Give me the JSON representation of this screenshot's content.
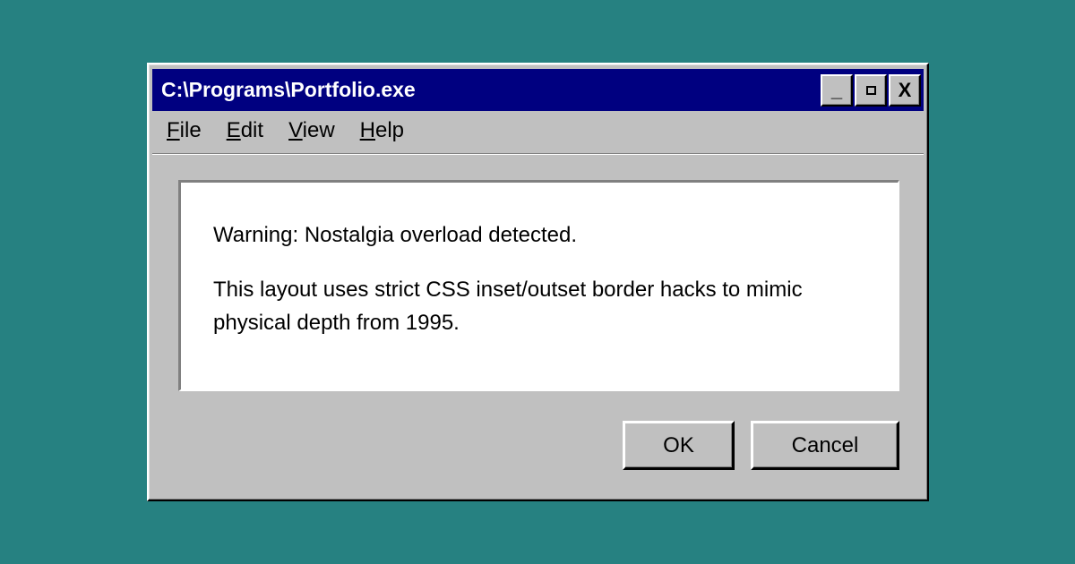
{
  "window": {
    "title": "C:\\Programs\\Portfolio.exe",
    "buttons": {
      "minimize": "_",
      "close": "X"
    }
  },
  "menu": [
    {
      "accel": "F",
      "rest": "ile"
    },
    {
      "accel": "E",
      "rest": "dit"
    },
    {
      "accel": "V",
      "rest": "iew"
    },
    {
      "accel": "H",
      "rest": "elp"
    }
  ],
  "dialog": {
    "line1": "Warning: Nostalgia overload detected.",
    "line2": "This layout uses strict CSS inset/outset border hacks to mimic physical depth from 1995."
  },
  "actions": {
    "ok_label": "OK",
    "cancel_label": "Cancel"
  },
  "colors": {
    "desktop": "#268181",
    "titlebar": "#000080",
    "face": "#c0c0c0"
  },
  "icons": [
    "minimize-icon",
    "maximize-icon",
    "close-icon"
  ]
}
